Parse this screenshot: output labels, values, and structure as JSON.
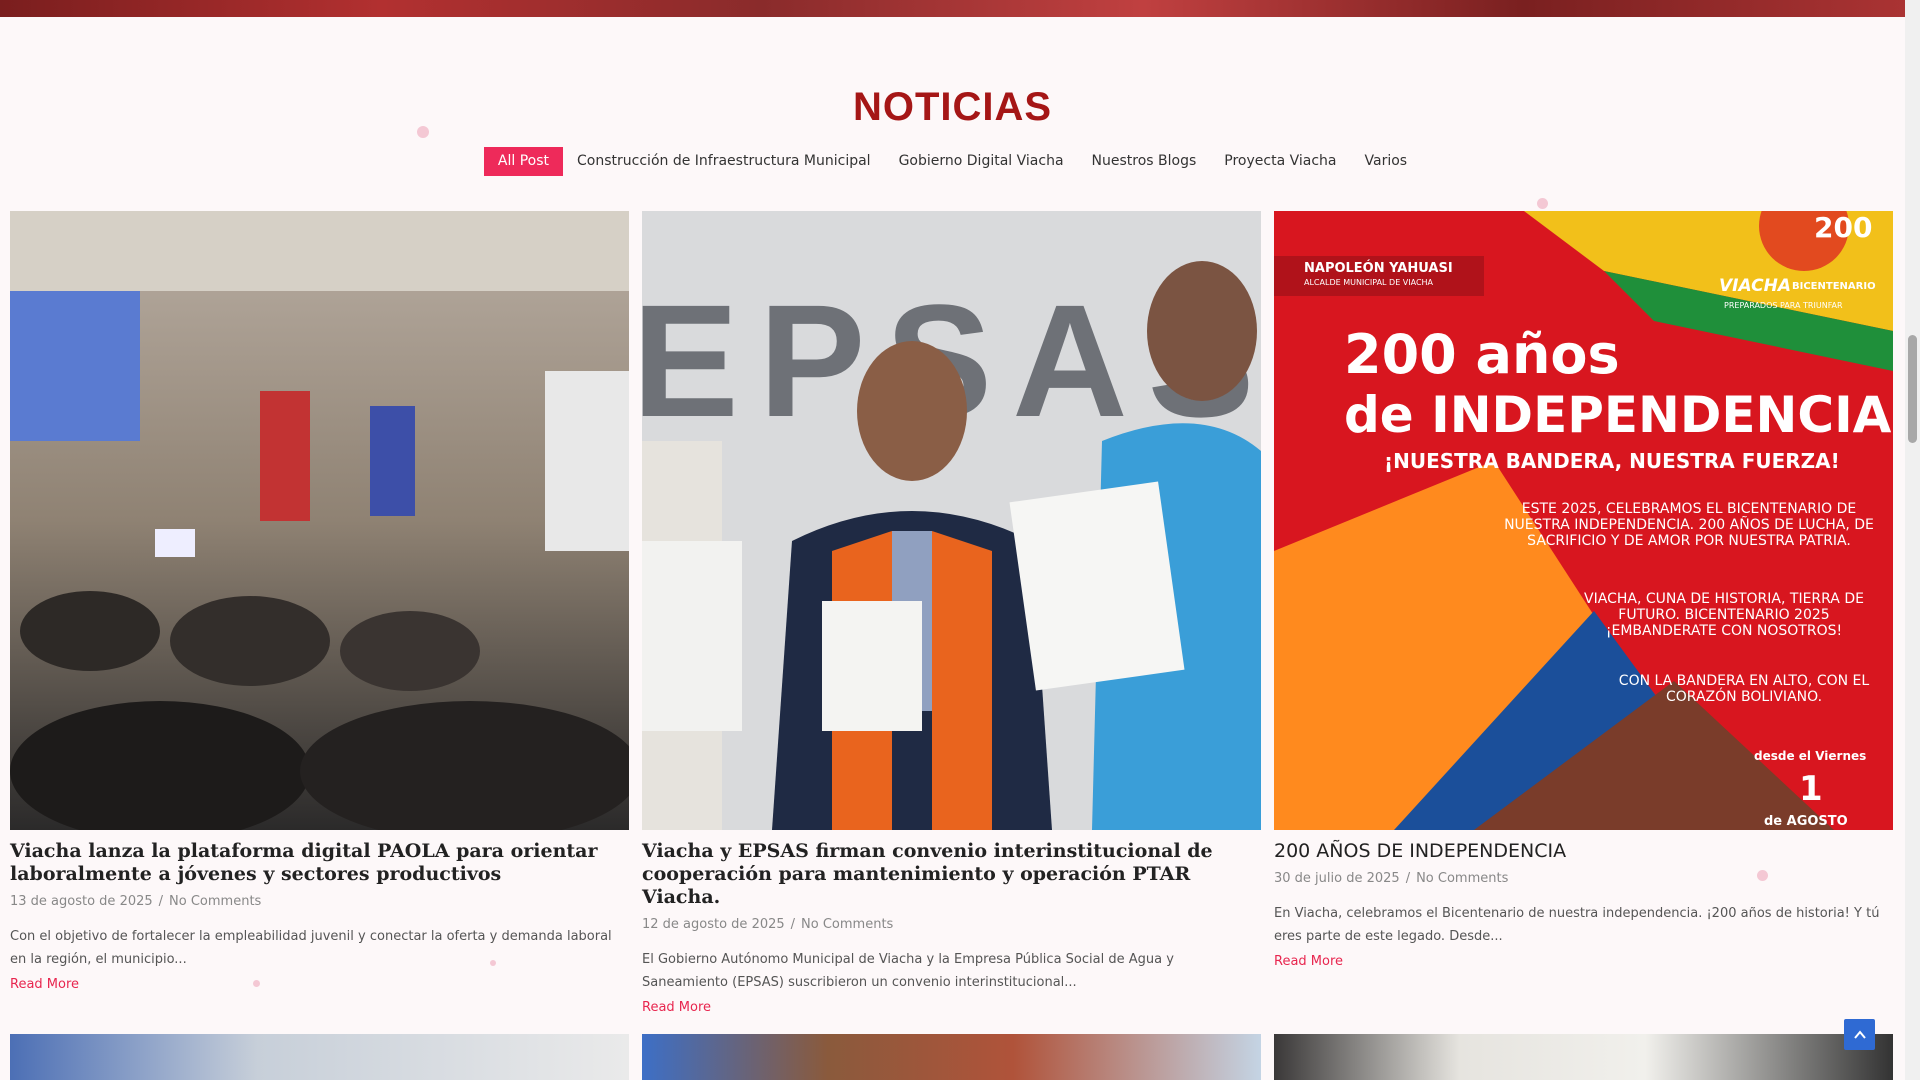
{
  "section": {
    "title": "NOTICIAS"
  },
  "filters": [
    {
      "label": "All Post",
      "active": true
    },
    {
      "label": "Construcción de Infraestructura Municipal",
      "active": false
    },
    {
      "label": "Gobierno Digital Viacha",
      "active": false
    },
    {
      "label": "Nuestros Blogs",
      "active": false
    },
    {
      "label": "Proyecta Viacha",
      "active": false
    },
    {
      "label": "Varios",
      "active": false
    }
  ],
  "posts": [
    {
      "title": "Viacha lanza la plataforma digital PAOLA para orientar laboralmente a jóvenes y sectores productivos",
      "date": "13 de agosto de 2025",
      "comments": "No Comments",
      "excerpt": "Con el objetivo de fortalecer la empleabilidad juvenil y conectar la oferta y demanda laboral en la región, el municipio...",
      "read_more": "Read More",
      "image_alt": "Presentation in a conference room"
    },
    {
      "title": "Viacha y EPSAS firman convenio interinstitucional de cooperación para mantenimiento y operación PTAR Viacha.",
      "date": "12 de agosto de 2025",
      "comments": "No Comments",
      "excerpt": "El Gobierno Autónomo Municipal de Viacha y la Empresa Pública Social de Agua y Saneamiento (EPSAS) suscribieron un convenio interinstitucional...",
      "read_more": "Read More",
      "image_text": "EPSAS"
    },
    {
      "title": "200 AÑOS DE INDEPENDENCIA",
      "date": "30 de julio de 2025",
      "comments": "No Comments",
      "excerpt": "En Viacha, celebramos el Bicentenario de nuestra independencia. ¡200 años de historia! Y tú eres parte de este legado. Desde...",
      "read_more": "Read More",
      "poster": {
        "name": "NAPOLEÓN YAHUASI",
        "role": "ALCALDE MUNICIPAL DE VIACHA",
        "headline1": "200 años",
        "headline2": "de INDEPENDENCIA",
        "slogan": "¡NUESTRA BANDERA, NUESTRA FUERZA!",
        "bullet1": "ESTE 2025, CELEBRAMOS EL BICENTENARIO DE NUESTRA INDEPENDENCIA. 200 AÑOS DE LUCHA, DE SACRIFICIO Y DE AMOR POR NUESTRA PATRIA.",
        "bullet2": "VIACHA, CUNA DE HISTORIA, TIERRA DE FUTURO. BICENTENARIO 2025 ¡EMBANDERATE CON NOSOTROS!",
        "bullet3": "CON LA BANDERA EN ALTO, CON EL CORAZÓN BOLIVIANO.",
        "date_label": "desde el Viernes",
        "day": "1",
        "month": "de AGOSTO",
        "brand": "VIACHA",
        "brand_sub": "BICENTENARIO",
        "brand_tag": "PREPARADOS PARA TRIUNFAR",
        "badge": "200"
      }
    }
  ],
  "colors": {
    "accent": "#ee2a5a",
    "title": "#a51616",
    "scroll_button": "#2f6ad3"
  }
}
